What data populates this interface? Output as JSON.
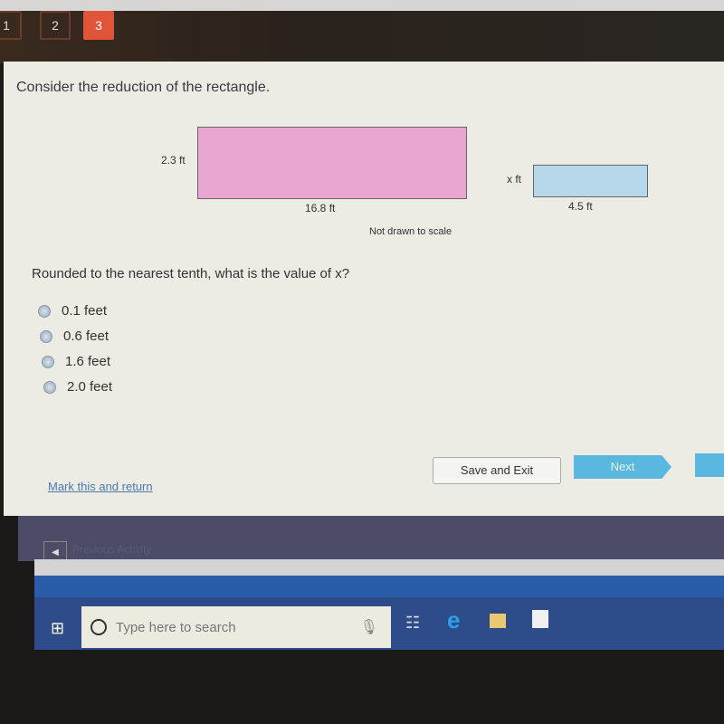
{
  "nav": {
    "questions": [
      "1",
      "2",
      "3"
    ],
    "active": "3"
  },
  "prompt": "Consider the reduction of the rectangle.",
  "figure": {
    "large_height": "2.3 ft",
    "large_width": "16.8 ft",
    "small_height": "x ft",
    "small_width": "4.5 ft",
    "note": "Not drawn to scale",
    "large_color": "#e8a6d0",
    "small_color": "#b6d8ea"
  },
  "question": "Rounded to the nearest tenth, what is the value of x?",
  "options": [
    "0.1 feet",
    "0.6 feet",
    "1.6 feet",
    "2.0 feet"
  ],
  "actions": {
    "mark": "Mark this and return",
    "save": "Save and Exit",
    "next": "Next"
  },
  "footer": {
    "previous": "Previous Activity"
  },
  "taskbar": {
    "search_placeholder": "Type here to search"
  }
}
